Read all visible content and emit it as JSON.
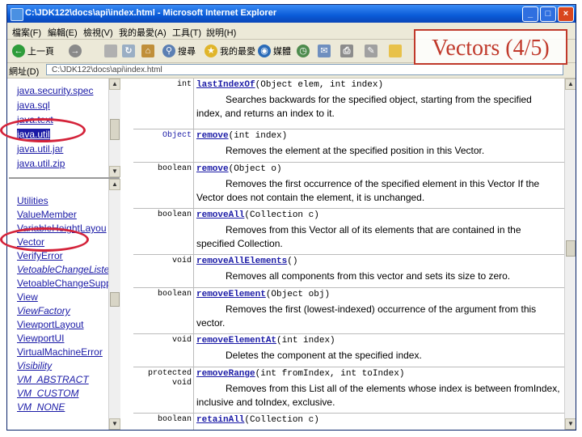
{
  "window": {
    "title": "C:\\JDK122\\docs\\api\\index.html - Microsoft Internet Explorer",
    "buttons": {
      "minimize": "_",
      "maximize": "□",
      "close": "×"
    }
  },
  "menubar": {
    "items": [
      "檔案(F)",
      "編輯(E)",
      "檢視(V)",
      "我的最愛(A)",
      "工具(T)",
      "說明(H)"
    ]
  },
  "toolbar": {
    "back": "上一頁",
    "search": "搜尋",
    "favorites": "我的最愛",
    "media": "媒體"
  },
  "address": {
    "label": "網址(D)",
    "value": "C:\\JDK122\\docs\\api\\index.html"
  },
  "slide": {
    "title": "Vectors (4/5)"
  },
  "left_frame": {
    "top_items": [
      "java.security.spec",
      "java.sql",
      "java.text",
      "java.util",
      "java.util.jar",
      "java.util.zip"
    ],
    "selected_top": "java.util",
    "bottom_items": [
      {
        "label": "Utilities",
        "italic": false
      },
      {
        "label": "ValueMember",
        "italic": false
      },
      {
        "label": "VariableHeightLayou",
        "italic": false
      },
      {
        "label": "Vector",
        "italic": false
      },
      {
        "label": "VerifyError",
        "italic": false
      },
      {
        "label": "VetoableChangeListe",
        "italic": true
      },
      {
        "label": "VetoableChangeSupp",
        "italic": false
      },
      {
        "label": "View",
        "italic": false
      },
      {
        "label": "ViewFactory",
        "italic": true
      },
      {
        "label": "ViewportLayout",
        "italic": false
      },
      {
        "label": "ViewportUI",
        "italic": false
      },
      {
        "label": "VirtualMachineError",
        "italic": false
      },
      {
        "label": "Visibility",
        "italic": true
      },
      {
        "label": "VM_ABSTRACT",
        "italic": true
      },
      {
        "label": "VM_CUSTOM",
        "italic": true
      },
      {
        "label": "VM_NONE",
        "italic": true
      }
    ]
  },
  "methods": [
    {
      "type": "int",
      "name": "lastIndexOf",
      "params": "(Object elem, int index)",
      "desc": "Searches backwards for the specified object, starting from the specified index, and returns an index to it."
    },
    {
      "type": "Object",
      "name": "remove",
      "params": "(int index)",
      "desc": "Removes the element at the specified position in this Vector."
    },
    {
      "type": "boolean",
      "name": "remove",
      "params": "(Object o)",
      "desc": "Removes the first occurrence of the specified element in this Vector If the Vector does not contain the element, it is unchanged."
    },
    {
      "type": "boolean",
      "name": "removeAll",
      "params": "(Collection c)",
      "desc": "Removes from this Vector all of its elements that are contained in the specified Collection."
    },
    {
      "type": "void",
      "name": "removeAllElements",
      "params": "()",
      "desc": "Removes all components from this vector and sets its size to zero."
    },
    {
      "type": "boolean",
      "name": "removeElement",
      "params": "(Object obj)",
      "desc": "Removes the first (lowest-indexed) occurrence of the argument from this vector."
    },
    {
      "type": "void",
      "name": "removeElementAt",
      "params": "(int index)",
      "desc": "Deletes the component at the specified index."
    },
    {
      "type": "protected\nvoid",
      "name": "removeRange",
      "params": "(int fromIndex, int toIndex)",
      "desc": "Removes from this List all of the elements whose index is between fromIndex, inclusive and toIndex, exclusive."
    },
    {
      "type": "boolean",
      "name": "retainAll",
      "params": "(Collection c)",
      "desc": ""
    }
  ],
  "colors": {
    "accent": "#d4233a",
    "link": "#1a1aa6",
    "titlebar": "#0a5bd8"
  }
}
